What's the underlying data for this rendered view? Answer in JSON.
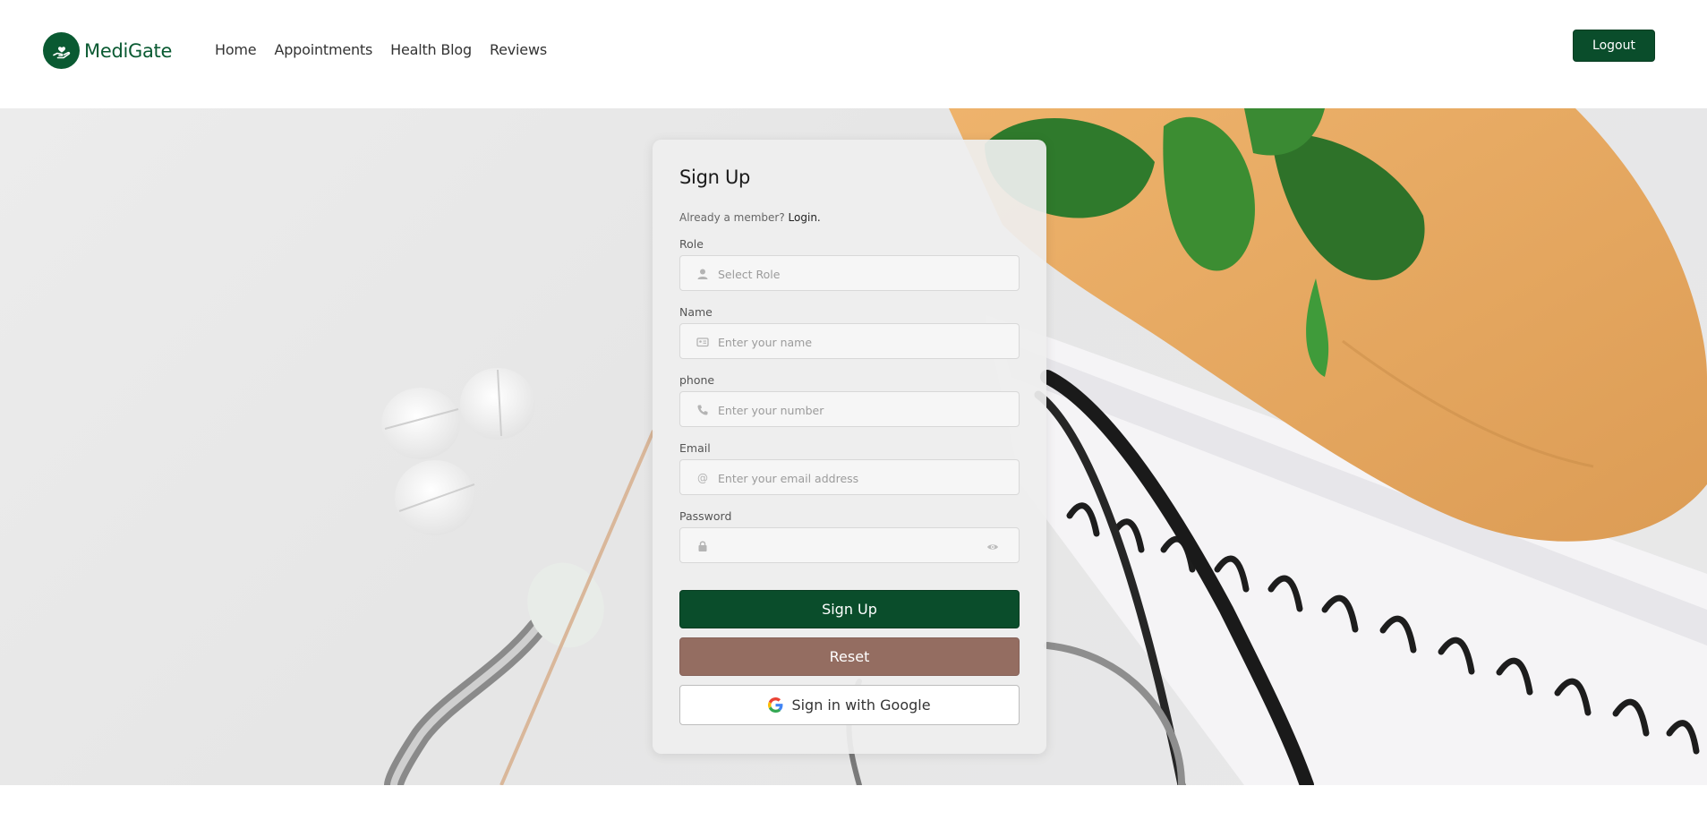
{
  "brand": {
    "name": "MediGate",
    "logo_icon": "hand-heart-icon",
    "color": "#0a5a32"
  },
  "nav": {
    "items": [
      "Home",
      "Appointments",
      "Health Blog",
      "Reviews"
    ]
  },
  "header": {
    "logout_label": "Logout"
  },
  "form": {
    "title": "Sign Up",
    "member_prompt": "Already a member?",
    "login_link": "Login.",
    "fields": {
      "role": {
        "label": "Role",
        "placeholder": "Select Role",
        "icon": "user-icon"
      },
      "name": {
        "label": "Name",
        "placeholder": "Enter your name",
        "icon": "id-card-icon"
      },
      "phone": {
        "label": "phone",
        "placeholder": "Enter your number",
        "icon": "phone-icon"
      },
      "email": {
        "label": "Email",
        "placeholder": "Enter your email address",
        "icon": "at-icon"
      },
      "password": {
        "label": "Password",
        "placeholder": "",
        "icon": "lock-icon"
      }
    },
    "buttons": {
      "signup": "Sign Up",
      "reset": "Reset",
      "google": "Sign in with Google"
    }
  },
  "colors": {
    "primary": "#0a4d2b",
    "reset": "#946d61",
    "card": "#eeeeee"
  }
}
